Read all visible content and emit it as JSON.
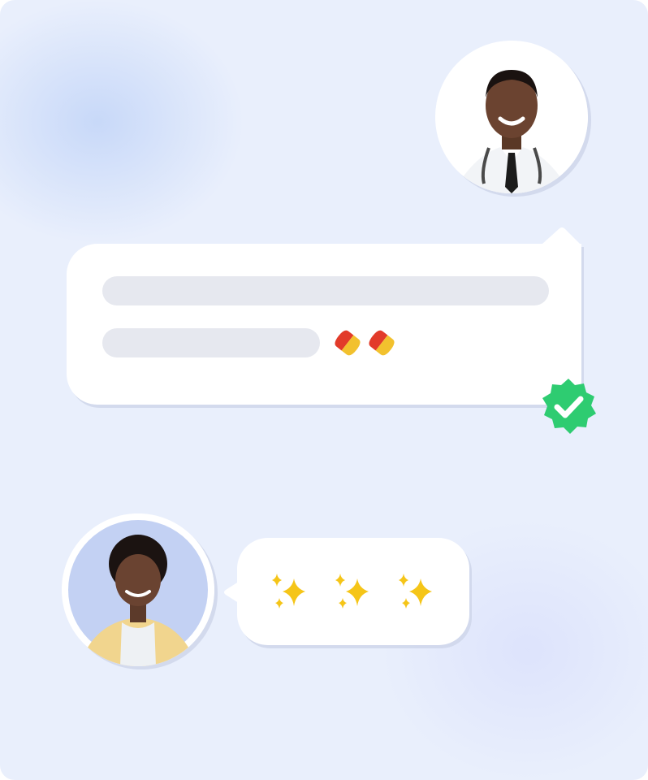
{
  "chat": {
    "doctor_message": {
      "emoji": [
        "pill-icon",
        "pill-icon"
      ]
    },
    "patient_message": {
      "emoji": [
        "sparkles-icon",
        "sparkles-icon",
        "sparkles-icon"
      ]
    },
    "status": {
      "icon": "verified-badge-icon"
    }
  },
  "colors": {
    "background": "#e9effc",
    "bubble": "#ffffff",
    "placeholder_line": "#e6e8ef",
    "verified": "#2ecc71",
    "patient_avatar_bg": "#c3d1f3"
  }
}
